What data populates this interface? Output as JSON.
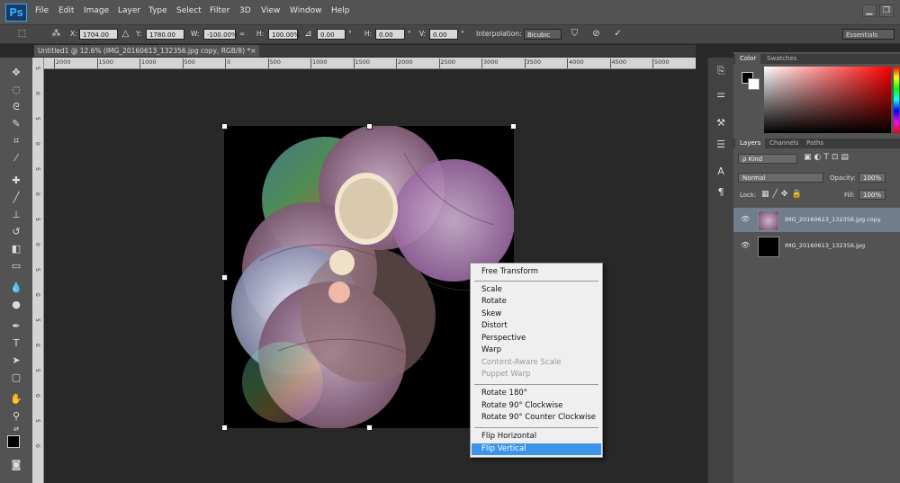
{
  "app": {
    "logo": "Ps"
  },
  "menu": [
    "File",
    "Edit",
    "Image",
    "Layer",
    "Type",
    "Select",
    "Filter",
    "3D",
    "View",
    "Window",
    "Help"
  ],
  "window_buttons": {
    "minimize": "▁",
    "restore": "❐"
  },
  "options": {
    "x_label": "X:",
    "x_value": "1704.00 px",
    "y_label": "Y:",
    "y_value": "1780.00 px",
    "w_label": "W:",
    "w_value": "-100.00%",
    "link_symbol": "∞",
    "h_label": "H:",
    "h_value": "100.00%",
    "angle_value": "0.00",
    "angle_unit": "°",
    "hskew_label": "H:",
    "hskew_value": "0.00",
    "hskew_unit": "°",
    "vskew_label": "V:",
    "vskew_value": "0.00",
    "vskew_unit": "°",
    "interp_label": "Interpolation:",
    "interp_value": "Bicubic",
    "workspace": "Essentials"
  },
  "document": {
    "tab_title": "Untitled1 @ 12.6% (IMG_20160613_132356.jpg copy, RGB/8) *",
    "close": "×"
  },
  "ruler_top_labels": [
    "2000",
    "1500",
    "1000",
    "500",
    "0",
    "500",
    "1000",
    "1500",
    "2000",
    "2500",
    "3000",
    "3500",
    "4000",
    "4500",
    "5000"
  ],
  "ruler_left_labels": [
    "5",
    "0",
    "5",
    "0",
    "5",
    "0",
    "5",
    "0",
    "5",
    "0",
    "5",
    "0",
    "5",
    "0",
    "5",
    "0"
  ],
  "context_menu": {
    "items": [
      {
        "label": "Free Transform",
        "state": "normal"
      },
      {
        "label": "Scale",
        "state": "normal"
      },
      {
        "label": "Rotate",
        "state": "normal"
      },
      {
        "label": "Skew",
        "state": "normal"
      },
      {
        "label": "Distort",
        "state": "normal"
      },
      {
        "label": "Perspective",
        "state": "normal"
      },
      {
        "label": "Warp",
        "state": "normal"
      },
      {
        "label": "Content-Aware Scale",
        "state": "disabled"
      },
      {
        "label": "Puppet Warp",
        "state": "disabled"
      },
      {
        "label": "Rotate 180°",
        "state": "normal"
      },
      {
        "label": "Rotate 90° Clockwise",
        "state": "normal"
      },
      {
        "label": "Rotate 90° Counter Clockwise",
        "state": "normal"
      },
      {
        "label": "Flip Horizontal",
        "state": "normal"
      },
      {
        "label": "Flip Vertical",
        "state": "selected"
      }
    ]
  },
  "panels": {
    "color_tabs": [
      "Color",
      "Swatches"
    ],
    "layers_tabs": [
      "Layers",
      "Channels",
      "Paths"
    ],
    "kind_label": "ρ Kind",
    "blend_mode": "Normal",
    "opacity_label": "Opacity:",
    "opacity_value": "100%",
    "lock_label": "Lock:",
    "fill_label": "Fill:",
    "fill_value": "100%",
    "layers": [
      {
        "name": "IMG_20160613_132356.jpg copy",
        "selected": true
      },
      {
        "name": "IMG_20160613_132356.jpg",
        "selected": false
      }
    ]
  },
  "colors": {
    "accent": "#3d95ea",
    "menubar": "#535353",
    "canvas": "#282828"
  }
}
